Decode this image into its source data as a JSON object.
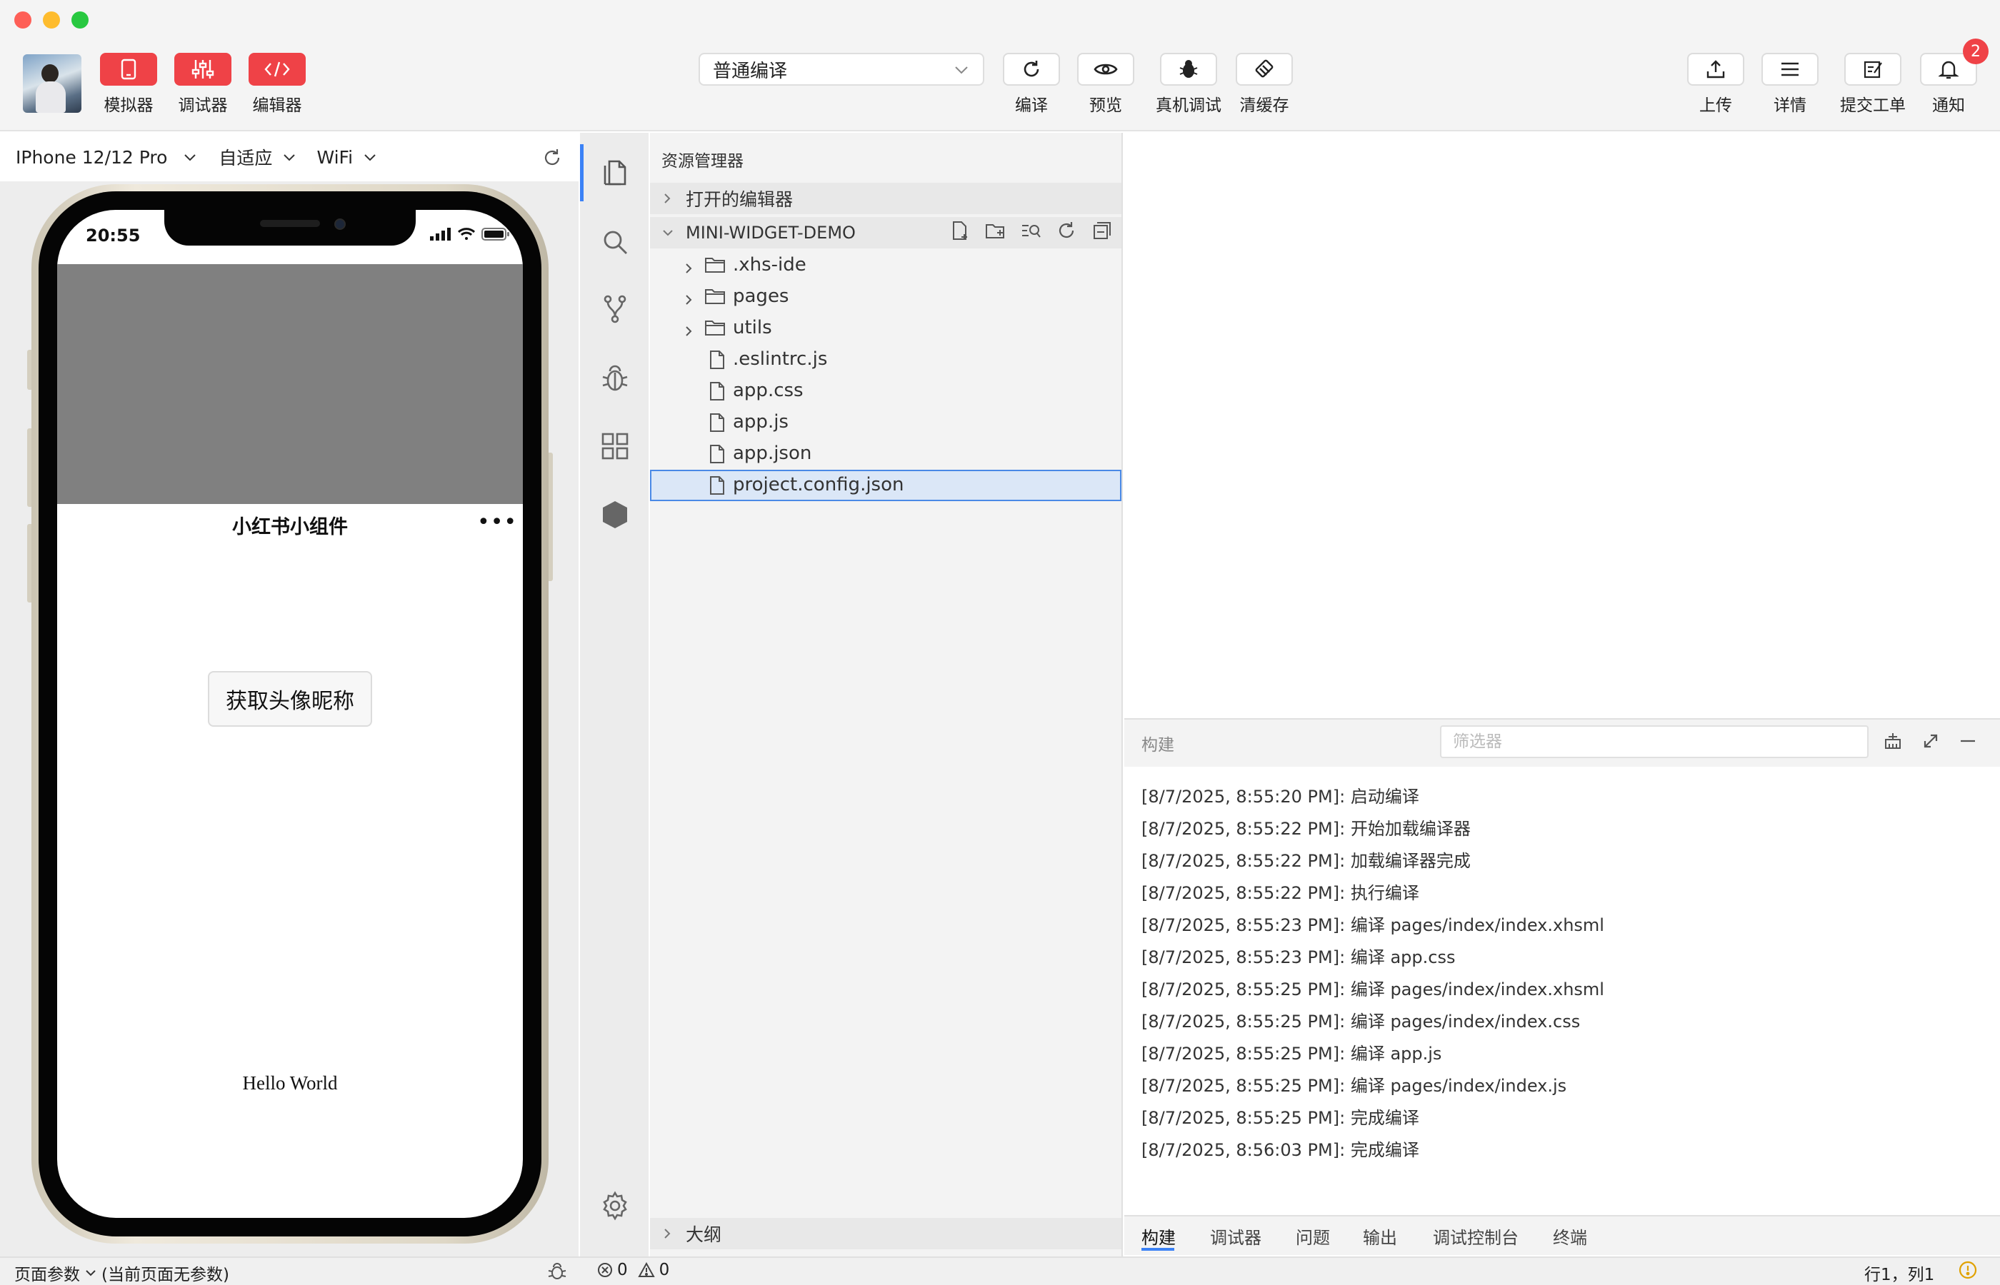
{
  "toolbar": {
    "left": [
      {
        "label": "模拟器"
      },
      {
        "label": "调试器"
      },
      {
        "label": "编辑器"
      }
    ],
    "compile_mode": "普通编译",
    "center": [
      {
        "label": "编译"
      },
      {
        "label": "预览"
      },
      {
        "label": "真机调试"
      },
      {
        "label": "清缓存"
      }
    ],
    "right": [
      {
        "label": "上传"
      },
      {
        "label": "详情"
      },
      {
        "label": "提交工单"
      },
      {
        "label": "通知"
      }
    ],
    "notification_count": "2"
  },
  "simulator": {
    "device": "IPhone 12/12 Pro",
    "scale": "自适应",
    "network": "WiFi",
    "status_time": "20:55",
    "page_title": "小红书小组件",
    "more": "•••",
    "button_label": "获取头像昵称",
    "hello_text": "Hello World"
  },
  "explorer": {
    "title": "资源管理器",
    "open_editors": "打开的编辑器",
    "project": "MINI-WIDGET-DEMO",
    "folders": [
      ".xhs-ide",
      "pages",
      "utils"
    ],
    "files": [
      ".eslintrc.js",
      "app.css",
      "app.js",
      "app.json",
      "project.config.json"
    ],
    "outline": "大纲"
  },
  "console": {
    "title": "构建",
    "filter_placeholder": "筛选器",
    "logs": [
      "[8/7/2025, 8:55:20 PM]: 启动编译",
      "[8/7/2025, 8:55:22 PM]: 开始加载编译器",
      "[8/7/2025, 8:55:22 PM]: 加载编译器完成",
      "[8/7/2025, 8:55:22 PM]: 执行编译",
      "[8/7/2025, 8:55:23 PM]: 编译 pages/index/index.xhsml",
      "[8/7/2025, 8:55:23 PM]: 编译 app.css",
      "[8/7/2025, 8:55:25 PM]: 编译 pages/index/index.xhsml",
      "[8/7/2025, 8:55:25 PM]: 编译 pages/index/index.css",
      "[8/7/2025, 8:55:25 PM]: 编译 app.js",
      "[8/7/2025, 8:55:25 PM]: 编译 pages/index/index.js",
      "[8/7/2025, 8:55:25 PM]: 完成编译",
      "[8/7/2025, 8:56:03 PM]: 完成编译"
    ],
    "tabs": [
      "构建",
      "调试器",
      "问题",
      "输出",
      "调试控制台",
      "终端"
    ]
  },
  "statusbar": {
    "page_params": "页面参数",
    "page_params_note": "(当前页面无参数)",
    "errors": "0",
    "warnings": "0",
    "cursor": "行1，列1"
  },
  "colors": {
    "accent_red": "#ef4247",
    "accent_blue": "#3b82f6",
    "selection": "#dbe7f7"
  }
}
